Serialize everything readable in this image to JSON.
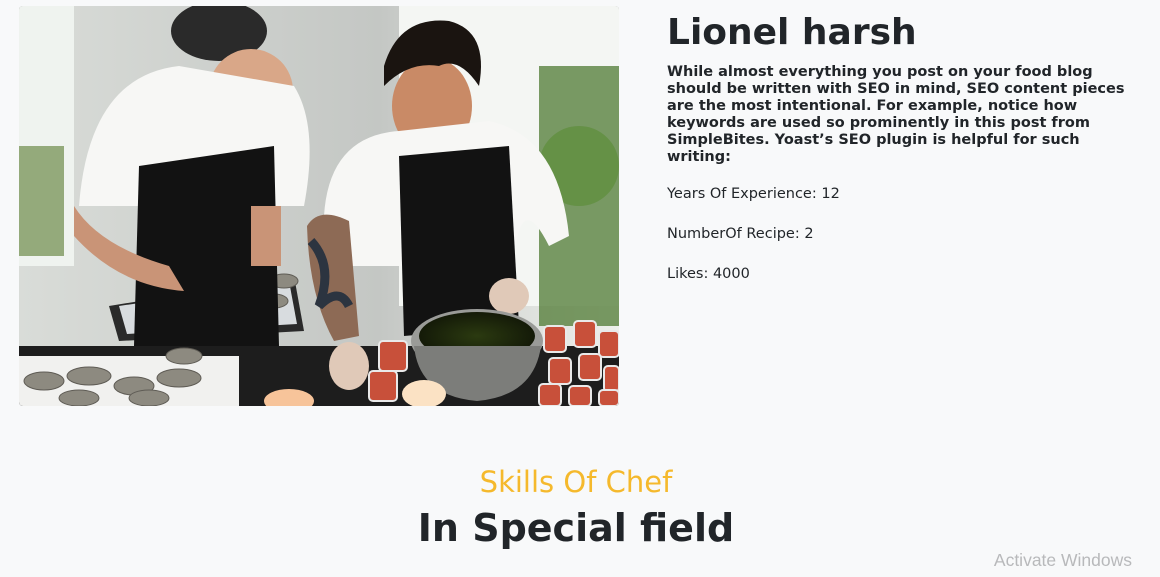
{
  "profile": {
    "photo_alt": "",
    "name": "Lionel harsh",
    "bio": "While almost everything you post on your food blog should be written with SEO in mind, SEO content pieces are the most intentional. For example, notice how keywords are used so prominently in this post from SimpleBites. Yoast’s SEO plugin is helpful for such writing:",
    "stats": {
      "experience": "Years Of Experience: 12",
      "recipes": "NumberOf Recipe: 2",
      "likes": "Likes: 4000"
    }
  },
  "skills": {
    "eyebrow": "Skills Of Chef",
    "title": "In Special field",
    "eyebrow_color": "#f5b92c"
  },
  "overlay": {
    "watermark": "Activate Windows"
  }
}
